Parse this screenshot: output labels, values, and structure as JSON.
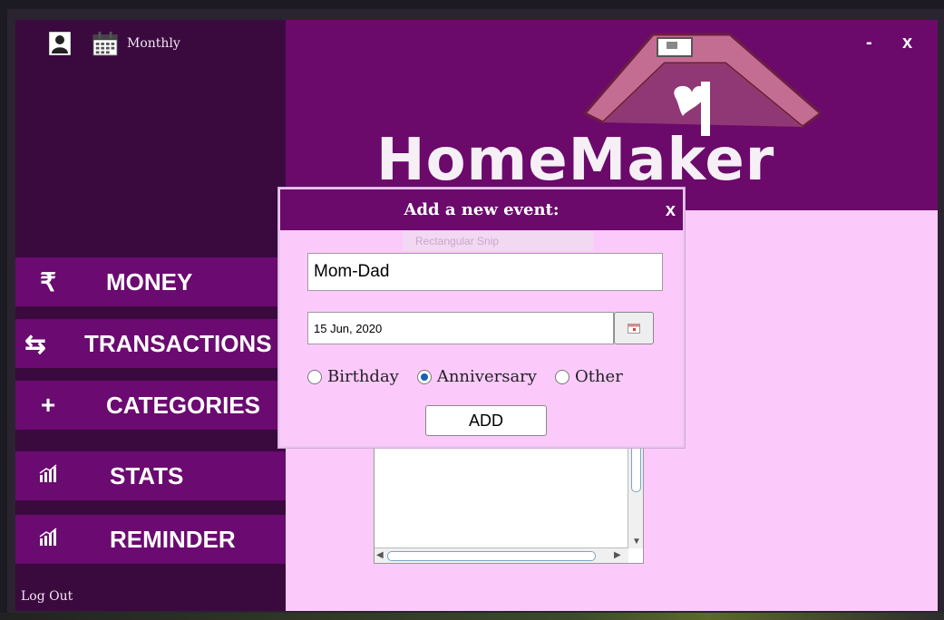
{
  "app": {
    "logo_text": "HomeMaker"
  },
  "sidebar": {
    "view_label": "Monthly",
    "items": [
      {
        "icon": "rupee",
        "label": "MONEY"
      },
      {
        "icon": "swap-arrows",
        "label": "TRANSACTIONS"
      },
      {
        "icon": "plus",
        "label": "CATEGORIES"
      },
      {
        "icon": "bar-chart",
        "label": "STATS"
      },
      {
        "icon": "bar-chart",
        "label": "REMINDER"
      }
    ],
    "logout_label": "Log Out"
  },
  "window": {
    "minimize_label": "-",
    "close_label": "x"
  },
  "dialog": {
    "title": "Add a new event:",
    "close_label": "x",
    "ghost_text": "Rectangular Snip",
    "name_value": "Mom-Dad",
    "date_value": "15 Jun, 2020",
    "options": [
      "Birthday",
      "Anniversary",
      "Other"
    ],
    "selected_option": "Anniversary",
    "add_label": "ADD"
  },
  "colors": {
    "sidebar": "#3a0a3f",
    "menu": "#6b0a70",
    "header": "#6b0a6b",
    "content": "#fbcafb"
  }
}
